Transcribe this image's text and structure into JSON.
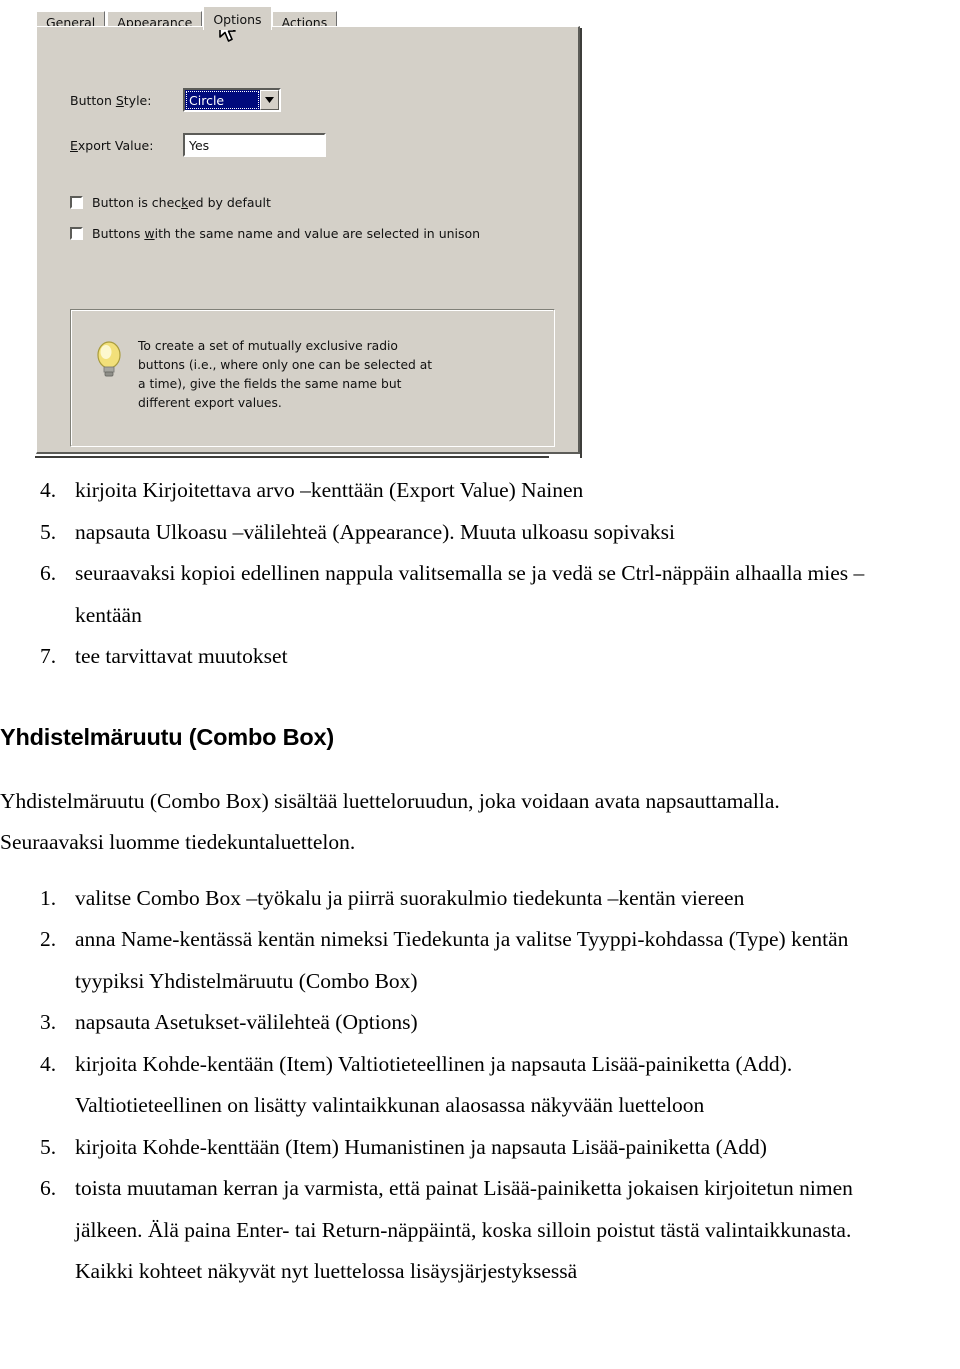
{
  "dialog": {
    "tabs": [
      {
        "label": "General",
        "active": false
      },
      {
        "label": "Appearance",
        "active": false
      },
      {
        "label": "Options",
        "active": true
      },
      {
        "label": "Actions",
        "active": false
      }
    ],
    "fields": {
      "button_style_label": "Button Style:",
      "button_style_value": "Circle",
      "export_value_label": "Export Value:",
      "export_value_value": "Yes"
    },
    "checkboxes": [
      {
        "label": "Button is checked by default",
        "checked": false
      },
      {
        "label": "Buttons with the same name and value are selected in unison",
        "checked": false
      }
    ],
    "tip": {
      "icon": "lightbulb-icon",
      "lines": [
        "To create a set of mutually exclusive radio",
        "buttons (i.e., where only one can be selected at",
        "a time), give the fields the same name but",
        "different export values."
      ]
    },
    "colors": {
      "face": "#d4d0c8",
      "selection": "#000a7c",
      "selection_text": "#ffffff",
      "bulb": "#f5e27a"
    }
  },
  "document": {
    "list_one": [
      {
        "num": "4.",
        "lines": [
          "kirjoita Kirjoitettava arvo –kenttään (Export Value) Nainen"
        ]
      },
      {
        "num": "5.",
        "lines": [
          "napsauta Ulkoasu –välilehteä (Appearance). Muuta ulkoasu sopivaksi"
        ]
      },
      {
        "num": "6.",
        "lines": [
          "seuraavaksi kopioi edellinen nappula valitsemalla se ja vedä se Ctrl-näppäin alhaalla mies –",
          "kentään"
        ]
      },
      {
        "num": "7.",
        "lines": [
          "tee tarvittavat muutokset"
        ]
      }
    ],
    "heading": "Yhdistelmäruutu (Combo Box)",
    "paragraphs": [
      "Yhdistelmäruutu (Combo Box) sisältää luetteloruudun, joka voidaan avata napsauttamalla.",
      "Seuraavaksi luomme tiedekuntaluettelon."
    ],
    "list_two": [
      {
        "num": "1.",
        "lines": [
          "valitse Combo Box –työkalu ja piirrä suorakulmio tiedekunta –kentän viereen"
        ]
      },
      {
        "num": "2.",
        "lines": [
          "anna Name-kentässä kentän nimeksi Tiedekunta ja valitse Tyyppi-kohdassa (Type) kentän",
          "tyypiksi Yhdistelmäruutu (Combo Box)"
        ]
      },
      {
        "num": "3.",
        "lines": [
          "napsauta Asetukset-välilehteä (Options)"
        ]
      },
      {
        "num": "4.",
        "lines": [
          "kirjoita Kohde-kentään (Item) Valtiotieteellinen ja napsauta Lisää-painiketta (Add).",
          "Valtiotieteellinen on lisätty valintaikkunan alaosassa näkyvään luetteloon"
        ]
      },
      {
        "num": "5.",
        "lines": [
          "kirjoita Kohde-kenttään (Item) Humanistinen ja napsauta Lisää-painiketta (Add)"
        ]
      },
      {
        "num": "6.",
        "lines": [
          "toista muutaman kerran ja varmista, että painat Lisää-painiketta jokaisen kirjoitetun nimen",
          "jälkeen. Älä paina Enter- tai Return-näppäintä, koska silloin poistut tästä valintaikkunasta.",
          "Kaikki kohteet näkyvät nyt luettelossa lisäysjärjestyksessä"
        ]
      }
    ]
  }
}
